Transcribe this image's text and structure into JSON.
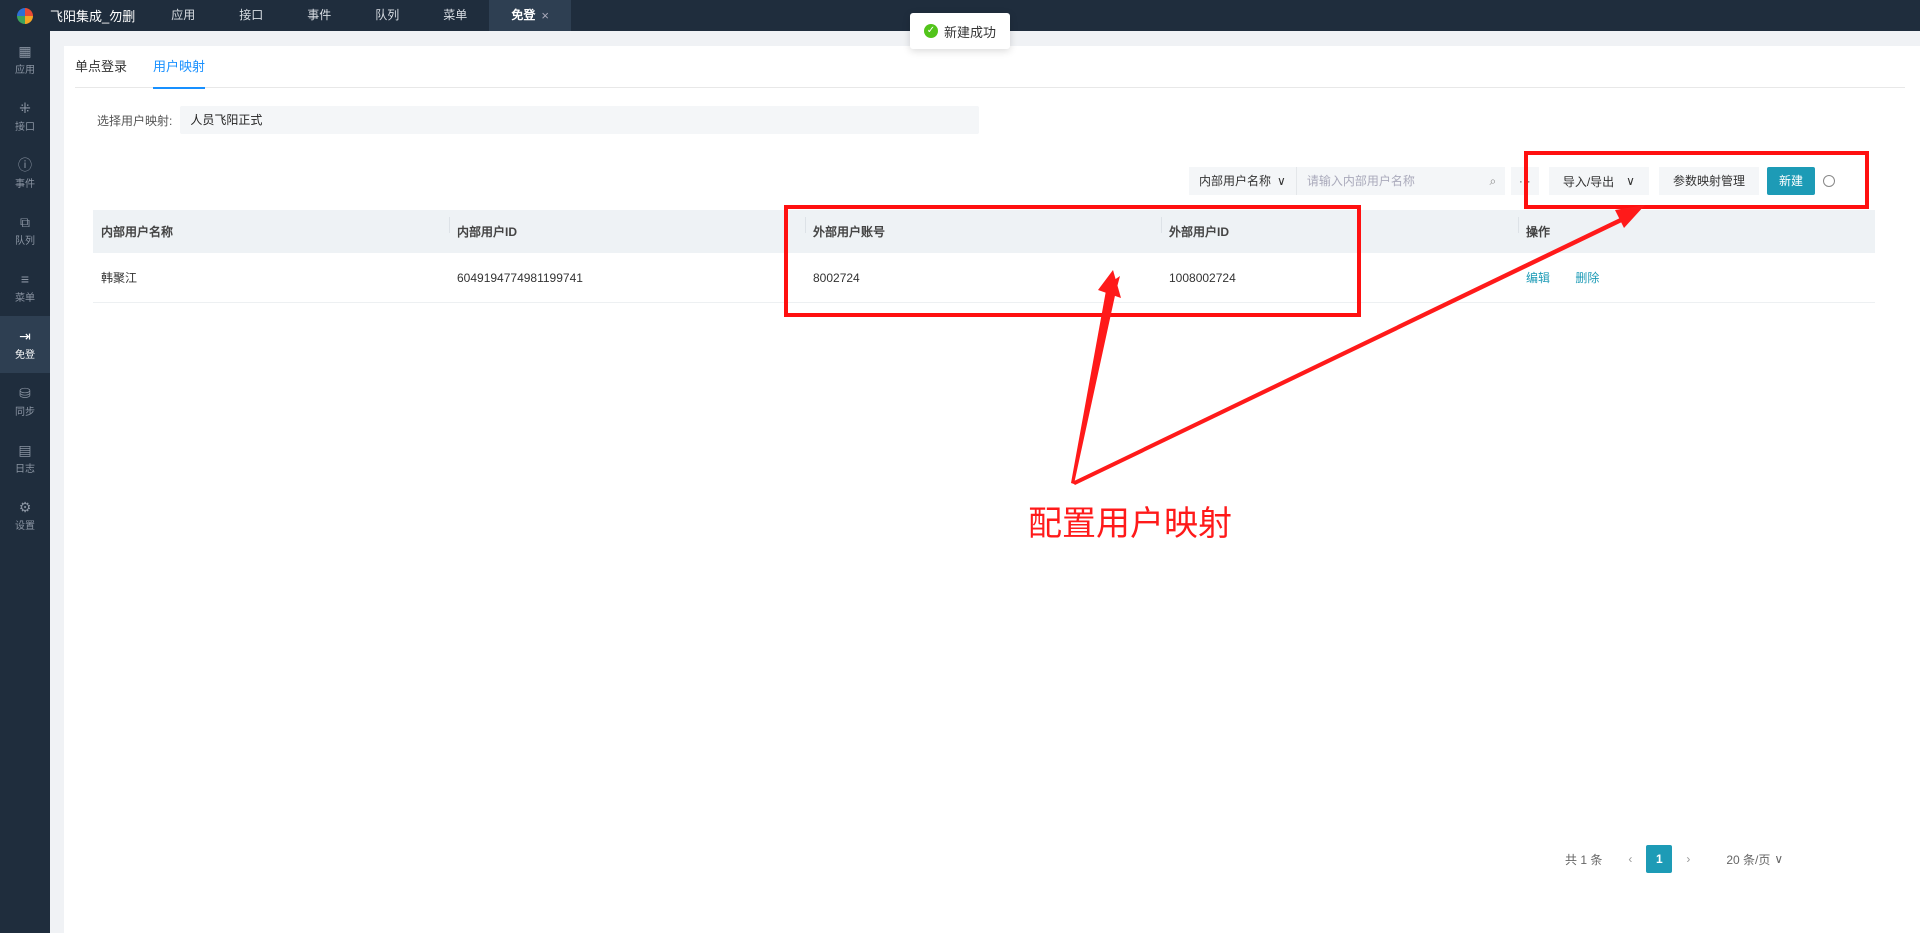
{
  "topbar": {
    "app_name": "飞阳集成_勿删",
    "tabs": [
      {
        "label": "应用"
      },
      {
        "label": "接口"
      },
      {
        "label": "事件"
      },
      {
        "label": "队列"
      },
      {
        "label": "菜单"
      },
      {
        "label": "免登",
        "active": true
      }
    ],
    "close_glyph": "×"
  },
  "sidebar": {
    "items": [
      {
        "label": "应用",
        "icon": "grid-icon",
        "glyph": "▦"
      },
      {
        "label": "接口",
        "icon": "network-icon",
        "glyph": "⁜"
      },
      {
        "label": "事件",
        "icon": "alert-icon",
        "glyph": "ⓘ"
      },
      {
        "label": "队列",
        "icon": "queue-icon",
        "glyph": "⧉"
      },
      {
        "label": "菜单",
        "icon": "menu-icon",
        "glyph": "≡"
      },
      {
        "label": "免登",
        "icon": "login-icon",
        "glyph": "⇥",
        "active": true
      },
      {
        "label": "同步",
        "icon": "database-icon",
        "glyph": "⛁"
      },
      {
        "label": "日志",
        "icon": "document-icon",
        "glyph": "▤"
      },
      {
        "label": "设置",
        "icon": "gear-icon",
        "glyph": "⚙"
      }
    ]
  },
  "toast": {
    "text": "新建成功",
    "icon": "check-circle-icon",
    "glyph": "✓"
  },
  "content_tabs": [
    {
      "label": "单点登录"
    },
    {
      "label": "用户映射",
      "active": true
    }
  ],
  "mapping_select": {
    "label": "选择用户映射:",
    "value": "人员飞阳正式"
  },
  "toolbar": {
    "filter_field": "内部用户名称",
    "filter_caret": "∨",
    "search_placeholder": "请输入内部用户名称",
    "search_glyph": "⌕",
    "more": "···",
    "import_export": "导入/导出",
    "import_export_caret": "∨",
    "param_mapping": "参数映射管理",
    "new": "新建"
  },
  "table": {
    "columns": [
      "内部用户名称",
      "内部用户ID",
      "外部用户账号",
      "外部用户ID",
      "操作"
    ],
    "rows": [
      {
        "name": "韩聚江",
        "internal_id": "6049194774981199741",
        "external_account": "8002724",
        "external_id": "1008002724",
        "actions": [
          "编辑",
          "删除"
        ]
      }
    ]
  },
  "pagination": {
    "total": "共 1 条",
    "prev": "‹",
    "page": "1",
    "next": "›",
    "page_size": "20 条/页",
    "size_caret": "∨"
  },
  "annotation": {
    "text": "配置用户映射",
    "color": "#ff1a1a"
  }
}
